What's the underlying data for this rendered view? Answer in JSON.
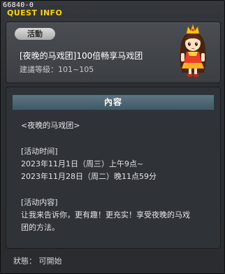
{
  "window": {
    "quest_id": "66840-0",
    "title": "QUEST INFO"
  },
  "quest": {
    "tag": "活動",
    "name": "[夜晚的马戏团]100倍畅享马戏团",
    "level": "建議等級：101~105"
  },
  "content": {
    "header": "內容",
    "lines": [
      "<夜晚的马戏团>",
      "",
      "[活动时间]",
      "2023年11月1日（周三）上午9点~",
      "2023年11月28日（周二）晚11点59分",
      "",
      "[活动内容]",
      "让我来告诉你，更有趣！更充实！享受夜晚的马戏",
      "团的方法。"
    ]
  },
  "status": {
    "text": "狀態： 可開始"
  },
  "colors": {
    "title": "#ffd400",
    "header_bg": "#4f6a77",
    "tag_bg": "#c4c4c4"
  }
}
